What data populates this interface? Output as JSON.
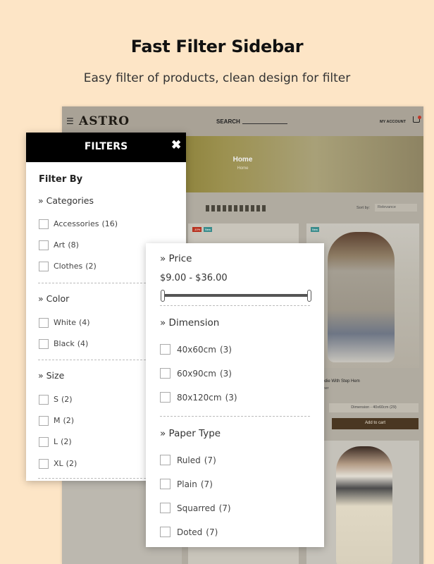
{
  "hero": {
    "title": "Fast Filter Sidebar",
    "subtitle": "Easy filter of products, clean design for filter"
  },
  "shop": {
    "logo": "ASTRO",
    "search_label": "SEARCH",
    "account_label": "MY ACCOUNT",
    "banner_title": "Home",
    "banner_crumb": "Home",
    "sort_label": "Sort by:",
    "sort_value": "Relevance",
    "product_name": "eved Hoodie With Step Hem",
    "product_category": "aphic Corner",
    "dimension_select": "Dimension - 40x60cm (29)",
    "add_to_cart": "Add to cart",
    "badge_sale": "-10%",
    "badge_new": "New"
  },
  "filters": {
    "header": "FILTERS",
    "close_symbol": "✖",
    "filter_by": "Filter By",
    "sections": {
      "categories": {
        "title": "» Categories",
        "options": [
          {
            "label": "Accessories",
            "count": "(16)"
          },
          {
            "label": "Art",
            "count": "(8)"
          },
          {
            "label": "Clothes",
            "count": "(2)"
          }
        ]
      },
      "color": {
        "title": "» Color",
        "options": [
          {
            "label": "White",
            "count": "(4)"
          },
          {
            "label": "Black",
            "count": "(4)"
          }
        ]
      },
      "size": {
        "title": "» Size",
        "options": [
          {
            "label": "S",
            "count": "(2)"
          },
          {
            "label": "M",
            "count": "(2)"
          },
          {
            "label": "L",
            "count": "(2)"
          },
          {
            "label": "XL",
            "count": "(2)"
          }
        ]
      }
    }
  },
  "price_panel": {
    "price_title": "» Price",
    "price_range": "$9.00 - $36.00",
    "slider_min_fraction": 0,
    "slider_max_fraction": 1,
    "dimension_title": "» Dimension",
    "dimension_options": [
      {
        "label": "40x60cm",
        "count": "(3)"
      },
      {
        "label": "60x90cm",
        "count": "(3)"
      },
      {
        "label": "80x120cm",
        "count": "(3)"
      }
    ],
    "paper_title": "» Paper Type",
    "paper_options": [
      {
        "label": "Ruled",
        "count": "(7)"
      },
      {
        "label": "Plain",
        "count": "(7)"
      },
      {
        "label": "Squarred",
        "count": "(7)"
      },
      {
        "label": "Doted",
        "count": "(7)"
      }
    ]
  },
  "colors": {
    "background": "#fde5c6",
    "filter_header": "#000000",
    "cart_button": "#4a3722"
  }
}
